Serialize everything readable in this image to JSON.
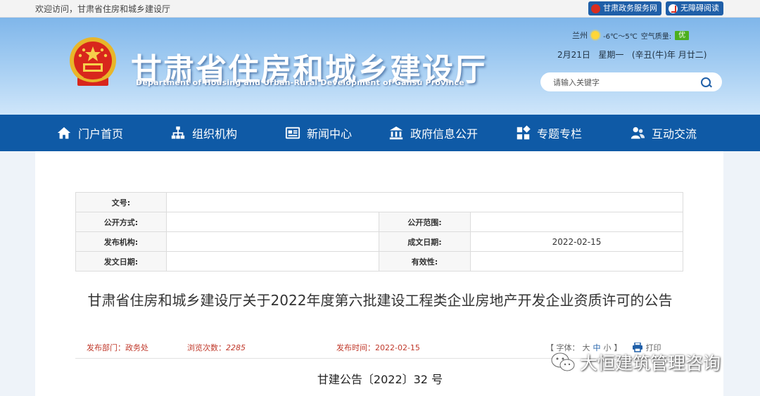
{
  "topbar": {
    "welcome": "欢迎访问，甘肃省住房和城乡建设厅",
    "btn_gov": "甘肃政务服务网",
    "btn_access": "无障碍阅读"
  },
  "header": {
    "title": "甘肃省住房和城乡建设厅",
    "subtitle": "Department of Housing and Urban-Rural Development of Gansu Province",
    "city": "兰州",
    "temp": "-6℃～5℃",
    "aq_label": "空气质量:",
    "aq_value": "优",
    "date": "2月21日",
    "weekday": "星期一",
    "lunar": "(辛丑(牛)年 月廿二)",
    "search_placeholder": "请输入关键字"
  },
  "nav": [
    {
      "label": "门户首页",
      "icon": "home-icon"
    },
    {
      "label": "组织机构",
      "icon": "org-chart-icon"
    },
    {
      "label": "新闻中心",
      "icon": "news-icon"
    },
    {
      "label": "政府信息公开",
      "icon": "government-building-icon"
    },
    {
      "label": "专题专栏",
      "icon": "grid-icon"
    },
    {
      "label": "互动交流",
      "icon": "users-icon"
    }
  ],
  "meta": {
    "doc_no_label": "文号:",
    "doc_no": "",
    "open_mode_label": "公开方式:",
    "open_mode": "",
    "open_scope_label": "公开范围:",
    "open_scope": "",
    "publisher_label": "发布机构:",
    "publisher": "",
    "written_date_label": "成文日期:",
    "written_date": "2022-02-15",
    "issue_date_label": "发文日期:",
    "issue_date": "",
    "validity_label": "有效性:",
    "validity": ""
  },
  "article": {
    "title": "甘肃省住房和城乡建设厅关于2022年度第六批建设工程类企业房地产开发企业资质许可的公告",
    "dept_label": "发布部门：",
    "dept": "政务处",
    "views_label": "浏览次数：",
    "views": "2285",
    "time_label": "发布时间：",
    "time": "2022-02-15",
    "font_label": "【 字体：",
    "font_large": "大",
    "font_medium": "中",
    "font_small": "小",
    "font_end": "】",
    "print": "打印",
    "doc_no": "甘建公告〔2022〕32 号"
  },
  "watermark": {
    "text": "大恒建筑管理咨询"
  },
  "colors": {
    "nav_bg": "#0f5aa6",
    "accent_red": "#c0392b",
    "aq_green": "#4caf1f"
  }
}
